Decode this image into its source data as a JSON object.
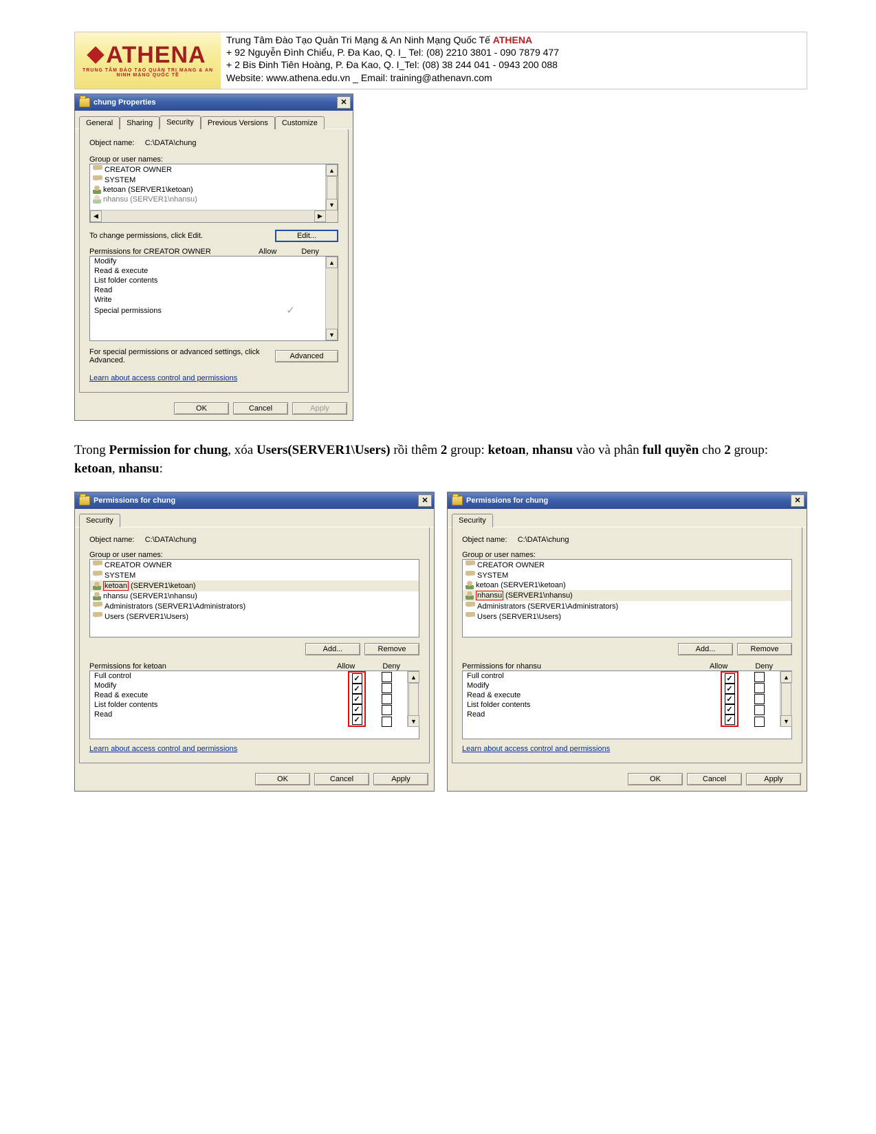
{
  "header": {
    "brand": "ATHENA",
    "sub": "TRUNG TÂM ĐÀO TẠO QUẢN TRỊ MẠNG & AN NINH MẠNG QUỐC TẾ",
    "line1_plain": "Trung Tâm Đào Tạo Quản Tri Mạng & An Ninh Mạng Quốc Tế ",
    "line1_bold": "ATHENA",
    "line2": "+  92 Nguyễn Đình Chiểu, P. Đa Kao, Q. I_ Tel: (08) 2210 3801 -  090 7879 477",
    "line3": "+  2 Bis Đinh Tiên Hoàng, P. Đa Kao, Q. I_Tel: (08) 38 244 041 - 0943 200 088",
    "line4": "Website:  www.athena.edu.vn     _       Email: training@athenavn.com"
  },
  "dlg1": {
    "title": "chung Properties",
    "tabs": [
      "General",
      "Sharing",
      "Security",
      "Previous Versions",
      "Customize"
    ],
    "active_tab": 2,
    "object_label": "Object name:",
    "object_path": "C:\\DATA\\chung",
    "groups_label": "Group or user names:",
    "groups": [
      {
        "name": "CREATOR OWNER",
        "icon": "people"
      },
      {
        "name": "SYSTEM",
        "icon": "people"
      },
      {
        "name": "ketoan (SERVER1\\ketoan)",
        "icon": "single"
      },
      {
        "name": "nhansu (SERVER1\\nhansu)",
        "icon": "single"
      }
    ],
    "edit_hint": "To change permissions, click Edit.",
    "edit_btn": "Edit...",
    "perm_for_label": "Permissions for CREATOR OWNER",
    "allow": "Allow",
    "deny": "Deny",
    "perms": [
      "Modify",
      "Read & execute",
      "List folder contents",
      "Read",
      "Write",
      "Special permissions"
    ],
    "special_has_grey_check": 5,
    "adv_hint": "For special permissions or advanced settings, click Advanced.",
    "adv_btn": "Advanced",
    "learn_link": "Learn about access control and permissions",
    "ok": "OK",
    "cancel": "Cancel",
    "apply": "Apply"
  },
  "instruction": {
    "p1": "Trong ",
    "b1": "Permission for chung",
    "p2": ", xóa ",
    "b2": "Users(SERVER1\\Users) ",
    "p3": "rồi thêm ",
    "b3": "2",
    "p4": " group: ",
    "b4": "ketoan",
    "p5": ", ",
    "b5": "nhansu",
    "p6": " vào và phân ",
    "b6": "full quyền ",
    "p7": "cho ",
    "b7": "2",
    "p8": " group: ",
    "b8": "ketoan",
    "p9": ", ",
    "b9": "nhansu",
    "p10": ":"
  },
  "dlg2": {
    "title": "Permissions for chung",
    "tab": "Security",
    "object_label": "Object name:",
    "object_path": "C:\\DATA\\chung",
    "groups_label": "Group or user names:",
    "groups": [
      {
        "name": "CREATOR OWNER",
        "icon": "people"
      },
      {
        "name": "SYSTEM",
        "icon": "people"
      },
      {
        "name_a": "ketoan",
        "name_b": " (SERVER1\\ketoan)",
        "icon": "single",
        "selected": true,
        "red_box": true
      },
      {
        "name": "nhansu (SERVER1\\nhansu)",
        "icon": "single"
      },
      {
        "name": "Administrators (SERVER1\\Administrators)",
        "icon": "people"
      },
      {
        "name": "Users (SERVER1\\Users)",
        "icon": "people"
      }
    ],
    "add_btn": "Add...",
    "remove_btn": "Remove",
    "perm_for_label": "Permissions for ketoan",
    "allow": "Allow",
    "deny": "Deny",
    "perms": [
      {
        "name": "Full control",
        "allow": true,
        "deny": false
      },
      {
        "name": "Modify",
        "allow": true,
        "deny": false
      },
      {
        "name": "Read & execute",
        "allow": true,
        "deny": false
      },
      {
        "name": "List folder contents",
        "allow": true,
        "deny": false
      },
      {
        "name": "Read",
        "allow": true,
        "deny": false
      }
    ],
    "learn_link": "Learn about access control and permissions",
    "ok": "OK",
    "cancel": "Cancel",
    "apply": "Apply"
  },
  "dlg3": {
    "title": "Permissions for chung",
    "tab": "Security",
    "object_label": "Object name:",
    "object_path": "C:\\DATA\\chung",
    "groups_label": "Group or user names:",
    "groups": [
      {
        "name": "CREATOR OWNER",
        "icon": "people"
      },
      {
        "name": "SYSTEM",
        "icon": "people"
      },
      {
        "name": "ketoan (SERVER1\\ketoan)",
        "icon": "single"
      },
      {
        "name_a": "nhansu",
        "name_b": " (SERVER1\\nhansu)",
        "icon": "single",
        "selected": true,
        "red_box": true
      },
      {
        "name": "Administrators (SERVER1\\Administrators)",
        "icon": "people"
      },
      {
        "name": "Users (SERVER1\\Users)",
        "icon": "people"
      }
    ],
    "add_btn": "Add...",
    "remove_btn": "Remove",
    "perm_for_label": "Permissions for nhansu",
    "allow": "Allow",
    "deny": "Deny",
    "perms": [
      {
        "name": "Full control",
        "allow": true,
        "deny": false
      },
      {
        "name": "Modify",
        "allow": true,
        "deny": false
      },
      {
        "name": "Read & execute",
        "allow": true,
        "deny": false
      },
      {
        "name": "List folder contents",
        "allow": true,
        "deny": false
      },
      {
        "name": "Read",
        "allow": true,
        "deny": false
      }
    ],
    "learn_link": "Learn about access control and permissions",
    "ok": "OK",
    "cancel": "Cancel",
    "apply": "Apply"
  }
}
